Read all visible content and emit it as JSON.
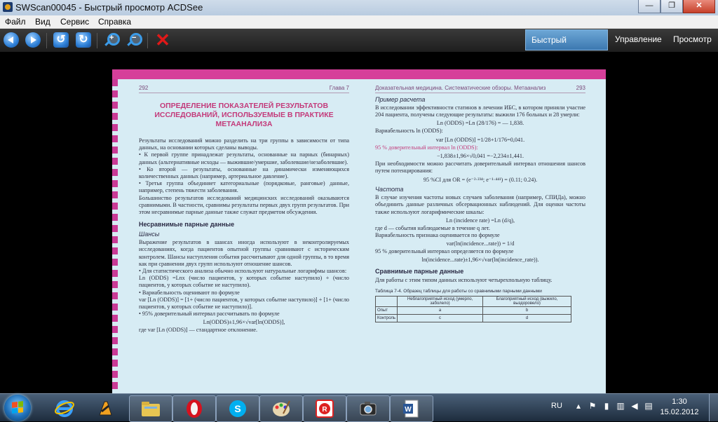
{
  "window": {
    "title": "SWScan00045 - Быстрый просмотр ACDSee",
    "minimize": "—",
    "restore": "❐",
    "close": "✕"
  },
  "menu": [
    "Файл",
    "Вид",
    "Сервис",
    "Справка"
  ],
  "toolbar": {
    "buttons": [
      "back-icon",
      "forward-icon",
      "rotate-left-icon",
      "rotate-right-icon",
      "zoom-in-icon",
      "zoom-out-icon",
      "delete-icon"
    ],
    "mode_tabs": [
      "Быстрый просмотр",
      "Управление",
      "Просмотр"
    ],
    "active_tab": "Быстрый просмотр"
  },
  "document": {
    "left": {
      "page_num": "292",
      "chapter": "Глава 7",
      "title_lines": [
        "ОПРЕДЕЛЕНИЕ ПОКАЗАТЕЛЕЙ РЕЗУЛЬТАТОВ",
        "ИССЛЕДОВАНИЙ, ИСПОЛЬЗУЕМЫЕ В ПРАКТИКЕ",
        "МЕТААНАЛИЗА"
      ],
      "intro": "Результаты исследований можно разделить на три группы в зависимости от типа данных, на основании которых сделаны выводы.",
      "bullets": [
        "К первой группе принадлежат результаты, основанные на парных (бинарных) данных (альтернативные исходы — выжившие/умершие, заболевшие/незаболевшие).",
        "Ко второй — результаты, основанные на динамически изменяющихся количественных данных (например, артериальное давление).",
        "Третья группа объединяет категориальные (порядковые, ранговые) данные, например, степень тяжести заболевания."
      ],
      "para2": "Большинство результатов исследований медицинских исследований оказываются сравнимыми. В частности, сравнимы результаты первых двух групп результатов. При этом несравнимые парные данные также служат предметом обсуждения.",
      "heading": "Несравнимые парные данные",
      "subheading": "Шансы",
      "para3": "Выражение результатов в шансах иногда используют в неконтролируемых исследованиях, когда пациентов опытной группы сравнивают с историческим контролем. Шансы наступления события рассчитывают для одной группы, в то время как при сравнении двух групп используют отношение шансов.",
      "bullet_a": "Для статистического анализа обычно используют натуральные логарифмы шансов:",
      "formula1": "Ln (ODDS) =Lnx (число пациентов, у которых событие наступило) + (число пациентов, у которых событие не наступило).",
      "bullet_b": "Вариабельность оценивают по формуле",
      "formula2": "var [Ln (ODDS)] = [1+ (число пациентов, у которых событие наступило)] + [1+ (число пациентов, у которых событие не наступило)].",
      "bullet_c": "95% доверительный интервал рассчитывать по формуле",
      "formula3": "Ln(ODDS)±1,96×√var[ln(ODDS)],",
      "tail": "где var [Ln (ODDS)] — стандартное отклонение."
    },
    "right": {
      "runhead": "Доказательная медицина. Систематические обзоры. Метаанализ",
      "page_num": "293",
      "example_h": "Пример расчета",
      "example": "В исследовании эффективности статинов в лечении ИБС, в котором приняли участие 204 пациента, получены следующие результаты: выжили 176 больных и 28 умерли:",
      "f1": "Ln (ODDS) =Ln (28/176) = — 1,838.",
      "var_h": "Вариабельность ln (ODDS):",
      "f2": "var [Ln (ODDS)] =1/28+1/176=0,041.",
      "ci_h": "95 % доверительный интервал ln (ODDS):",
      "f3": "−1,838±1,96×√0,041 =−2,234±1,441.",
      "p1": "При необходимости можно рассчитать доверительный интервал отношения шансов путем потенцирования:",
      "f4": "95 %CI для OR = (e⁻²·²³⁴; e⁻¹·⁴⁴¹) = (0.11; 0.24).",
      "freq_h": "Частота",
      "p2": "В случае изучения частоты новых случаев заболевания (например, СПИДа), можно объединить данные различных обсервационных наблюдений. Для оценки частоты также используют логарифмические шкалы:",
      "f5": "Ln (incidence rate) =Ln (d/q),",
      "p3": "где d — события наблюдаемые в течение q лет.",
      "p4": "Вариабельность признака оценивается по формуле",
      "f6": "var(ln(incidence...rate)) = 1/d",
      "p5": "95 % доверительный интервал определяется по формуле",
      "f7": "ln(incidence...rate)±1,96×√var(ln(incidence_rate)).",
      "comp_h": "Сравнимые парные данные",
      "p6": "Для работы с этим типом данных используют четырехпольную таблицу.",
      "table_caption": "Таблица 7-4. Образец таблицы для работы со сравнимыми парными данными",
      "table_head": [
        "",
        "Неблагоприятный исход (умерло, заболело)",
        "Благоприятный исход (выжило, выздоровело)"
      ],
      "table_rows": [
        [
          "Опыт",
          "a",
          "b"
        ],
        [
          "Контроль",
          "c",
          "d"
        ]
      ]
    }
  },
  "taskbar": {
    "apps": [
      "internet-explorer-icon",
      "winamp-icon",
      "file-explorer-icon",
      "opera-icon",
      "skype-icon",
      "paint-icon",
      "foxit-reader-icon",
      "acdsee-icon",
      "word-icon"
    ],
    "lang": "RU",
    "time": "1:30",
    "date": "15.02.2012"
  },
  "colors": {
    "accent_tab": "#4a8bc4",
    "title_pink": "#c33a7a",
    "page_bg": "#d7ecf4",
    "close_red": "#c6402a"
  }
}
